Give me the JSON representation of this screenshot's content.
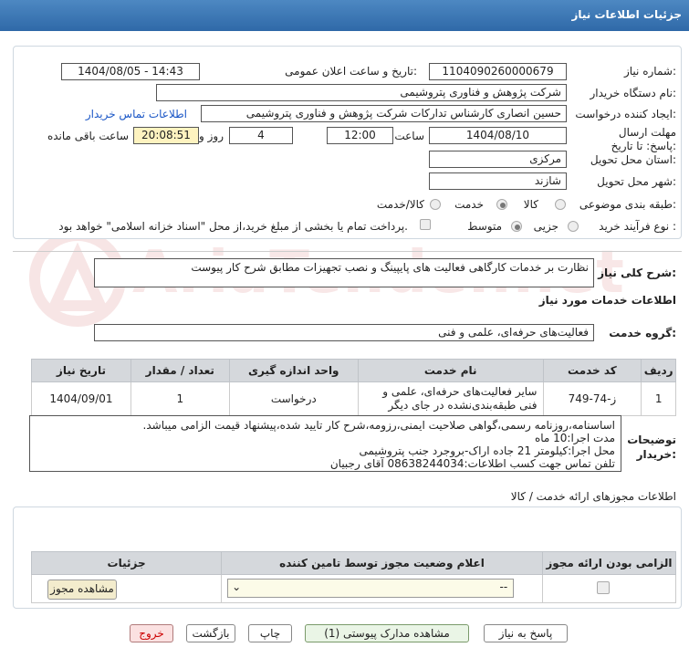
{
  "header": {
    "title": "جزئیات اطلاعات نیاز"
  },
  "form": {
    "need_number_label": "شماره نیاز:",
    "need_number": "1104090260000679",
    "announce_label": "تاریخ و ساعت اعلان عمومی:",
    "announce_value": "1404/08/05 - 14:43",
    "buyer_label": "نام دستگاه خریدار:",
    "buyer_value": "شرکت پژوهش و فناوری پتروشیمی",
    "creator_label": "ایجاد کننده درخواست:",
    "creator_value": "حسین انصاری کارشناس تدارکات شرکت پژوهش و فناوری پتروشیمی",
    "contact_link": "اطلاعات تماس خریدار",
    "deadline_label": "مهلت ارسال پاسخ: تا تاریخ:",
    "deadline_date": "1404/08/10",
    "time_label": "ساعت",
    "deadline_time": "12:00",
    "days_value": "4",
    "days_label": "روز و",
    "remaining_time": "20:08:51",
    "remaining_label": "ساعت باقی مانده",
    "province_label": "استان محل تحویل:",
    "province_value": "مرکزی",
    "city_label": "شهر محل تحویل:",
    "city_value": "شازند",
    "category_label": "طبقه بندی موضوعی:",
    "category_options": [
      "کالا",
      "خدمت",
      "کالا/خدمت"
    ],
    "process_label": "نوع فرآیند خرید :",
    "process_options": [
      "جزیی",
      "متوسط"
    ],
    "payment_note": "پرداخت تمام یا بخشی از مبلغ خرید،از محل \"اسناد خزانه اسلامی\" خواهد بود."
  },
  "summary": {
    "label": "شرح کلی نیاز:",
    "value": "نظارت بر خدمات کارگاهی فعالیت های پایپینگ و نصب تجهیزات مطابق شرح کار پیوست"
  },
  "services": {
    "section_title": "اطلاعات خدمات مورد نیاز",
    "group_label": "گروه خدمت:",
    "group_value": "فعالیت‌های حرفه‌ای، علمی و فنی",
    "columns": [
      "ردیف",
      "کد خدمت",
      "نام خدمت",
      "واحد اندازه گیری",
      "تعداد / مقدار",
      "تاریخ نیاز"
    ],
    "rows": [
      {
        "index": "1",
        "code": "ز-74-749",
        "name": "سایر فعالیت‌های حرفه‌ای، علمی و فنی طبقه‌بندی‌نشده در جای دیگر",
        "unit": "درخواست",
        "qty": "1",
        "date": "1404/09/01"
      }
    ]
  },
  "buyer_notes": {
    "label": "توضیحات خریدار:",
    "lines": [
      "اساسنامه،روزنامه رسمی،گواهی صلاحیت ایمنی،رزومه،شرح کار تایید شده،پیشنهاد قیمت الزامی میباشد.",
      "مدت اجرا:10 ماه",
      "محل اجرا:کیلومتر 21 جاده اراک-بروجرد جنب پتروشیمی",
      "تلفن تماس جهت کسب اطلاعات:08638244034 آقای رجبیان"
    ]
  },
  "permits": {
    "section_title": "اطلاعات مجوزهای ارائه خدمت / کالا",
    "columns": [
      "الزامی بودن ارائه مجوز",
      "اعلام وضعیت مجوز توسط تامین کننده",
      "جزئیات"
    ],
    "select_value": "--",
    "view_button": "مشاهده مجوز"
  },
  "actions": {
    "reply": "پاسخ به نیاز",
    "attachments": "مشاهده مدارک پیوستی (1)",
    "print": "چاپ",
    "back": "بازگشت",
    "exit": "خروج"
  },
  "watermark": {
    "text": "AriaTender.net"
  }
}
